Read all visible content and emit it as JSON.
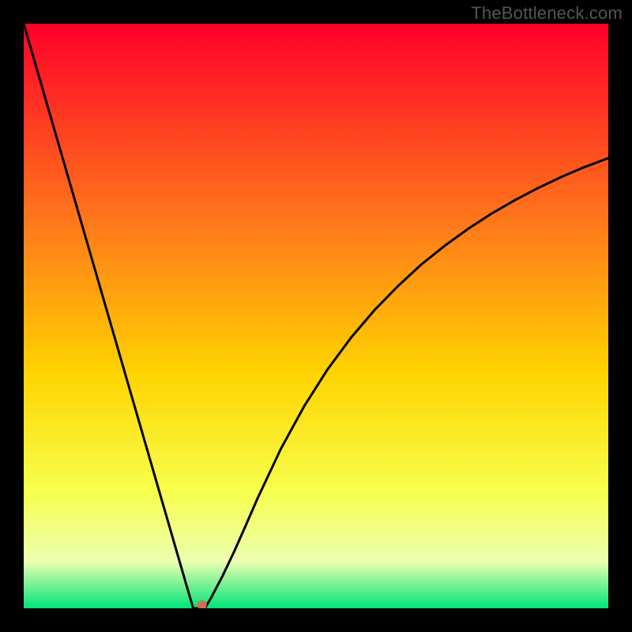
{
  "watermark": "TheBottleneck.com",
  "colors": {
    "page_bg": "#000000",
    "gradient_stops": [
      {
        "offset": "0%",
        "color": "#ff0028"
      },
      {
        "offset": "35%",
        "color": "#ff7c1a"
      },
      {
        "offset": "60%",
        "color": "#ffd400"
      },
      {
        "offset": "80%",
        "color": "#f7ff4d"
      },
      {
        "offset": "92%",
        "color": "#ecffb0"
      },
      {
        "offset": "100%",
        "color": "#00e47a"
      }
    ],
    "curve": "#000000",
    "marker": "#d66b5a"
  },
  "chart_data": {
    "type": "line",
    "title": "",
    "xlabel": "",
    "ylabel": "",
    "xlim": [
      0,
      100
    ],
    "ylim": [
      0,
      100
    ],
    "grid": false,
    "legend": false,
    "x": [
      0,
      2,
      4,
      6,
      8,
      10,
      12,
      14,
      16,
      18,
      20,
      22,
      24,
      26,
      28,
      29,
      30,
      31,
      32,
      34,
      36,
      38,
      40,
      44,
      48,
      52,
      56,
      60,
      64,
      68,
      72,
      76,
      80,
      84,
      88,
      92,
      96,
      100
    ],
    "values": [
      100,
      93.1,
      86.2,
      79.3,
      72.4,
      65.5,
      58.6,
      51.7,
      44.8,
      37.9,
      31.0,
      24.1,
      17.2,
      10.3,
      3.4,
      0,
      0,
      0,
      1.7,
      5.5,
      9.7,
      14.2,
      18.8,
      27.3,
      34.6,
      40.9,
      46.3,
      51.0,
      55.1,
      58.8,
      62.0,
      64.9,
      67.5,
      69.8,
      71.9,
      73.8,
      75.5,
      77.0
    ],
    "marker": {
      "x": 30.5,
      "y": 0
    }
  }
}
